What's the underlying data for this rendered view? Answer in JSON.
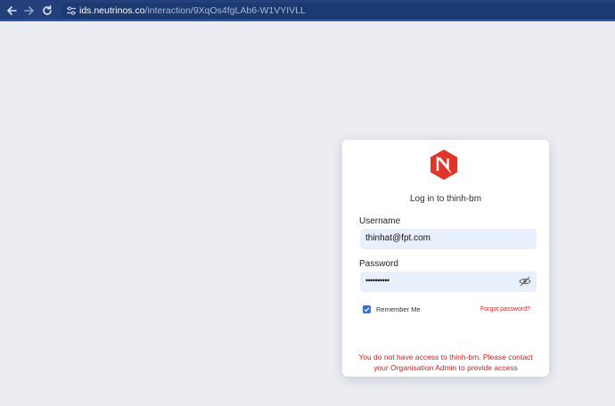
{
  "browser": {
    "url_host": "ids.neutrinos.co",
    "url_path": "/interaction/9XqOs4fgLAb6-W1VYIVLL",
    "back_icon": "arrow-left-icon",
    "forward_icon": "arrow-right-icon",
    "reload_icon": "reload-icon",
    "site_info_icon": "tune-icon"
  },
  "login": {
    "logo_icon": "neutrinos-logo",
    "title": "Log in to thinh-bm",
    "username_label": "Username",
    "username_value": "thinhat@fpt.com",
    "password_label": "Password",
    "password_mask": "••••••••••",
    "remember_label": "Remember Me",
    "remember_checked": true,
    "forgot_label": "Forgot password?",
    "error_line1": "You do not have access to thinh-bm. Please contact",
    "error_line2": "your Organisation Admin to provide access"
  },
  "colors": {
    "toolbar": "#23407a",
    "page_bg": "#ebedf2",
    "logo_red": "#e0352b",
    "input_bg": "#e8f0fe",
    "error_red": "#c62020",
    "checkbox_blue": "#2f6fe0"
  }
}
